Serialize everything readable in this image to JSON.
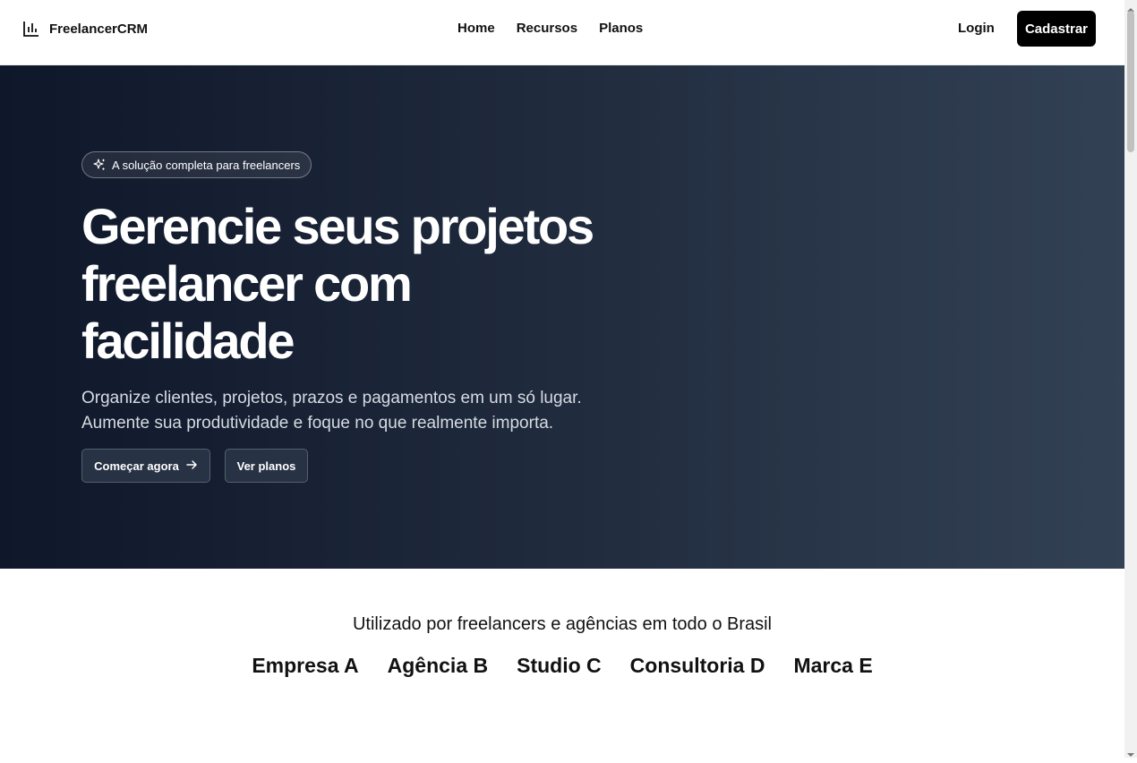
{
  "header": {
    "brand": "FreelancerCRM",
    "nav": [
      "Home",
      "Recursos",
      "Planos"
    ],
    "login": "Login",
    "signup": "Cadastrar"
  },
  "hero": {
    "badge": "A solução completa para freelancers",
    "title_lines": [
      "Gerencie seus projetos",
      "freelancer com",
      "facilidade"
    ],
    "subtitle_lines": [
      "Organize clientes, projetos, prazos e pagamentos em um só lugar.",
      "Aumente sua produtividade e foque no que realmente importa."
    ],
    "cta_primary": "Começar agora",
    "cta_secondary": "Ver planos"
  },
  "trusted": {
    "heading": "Utilizado por freelancers e agências em todo o Brasil",
    "logos": [
      "Empresa A",
      "Agência B",
      "Studio C",
      "Consultoria D",
      "Marca E"
    ]
  },
  "colors": {
    "hero_gradient_start": "#0f172a",
    "hero_gradient_end": "#334155",
    "primary_button": "#000000"
  },
  "icons": {
    "brand": "bar-chart-icon",
    "badge": "sparkles-icon",
    "cta": "arrow-right-icon"
  }
}
